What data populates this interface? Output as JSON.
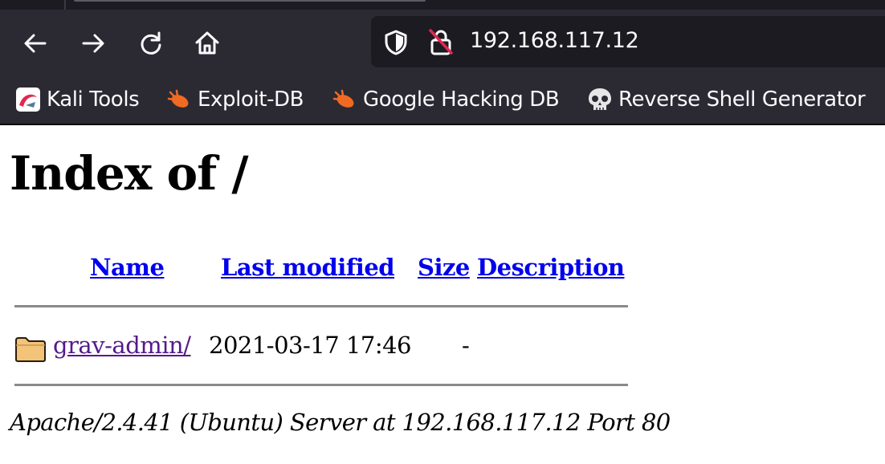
{
  "browser": {
    "url": "192.168.117.12",
    "bookmarks": [
      {
        "label": "Kali Tools",
        "icon": "kali-logo-icon"
      },
      {
        "label": "Exploit-DB",
        "icon": "exploit-db-bug-icon"
      },
      {
        "label": "Google Hacking DB",
        "icon": "ghdb-bug-icon"
      },
      {
        "label": "Reverse Shell Generator",
        "icon": "skull-icon"
      }
    ],
    "colors": {
      "chrome": "#2b2a33",
      "urlbar": "#1c1b22",
      "text": "#fbfbfe"
    }
  },
  "page": {
    "heading": "Index of /",
    "columns": {
      "name": "Name",
      "last_modified": "Last modified",
      "size": "Size",
      "description": "Description"
    },
    "rows": [
      {
        "name": "grav-admin/",
        "last_modified": "2021-03-17 17:46",
        "size": "-",
        "description": "",
        "icon": "folder-icon"
      }
    ],
    "address": "Apache/2.4.41 (Ubuntu) Server at 192.168.117.12 Port 80",
    "colors": {
      "link": "#0000ee",
      "visited": "#551a8b"
    }
  }
}
